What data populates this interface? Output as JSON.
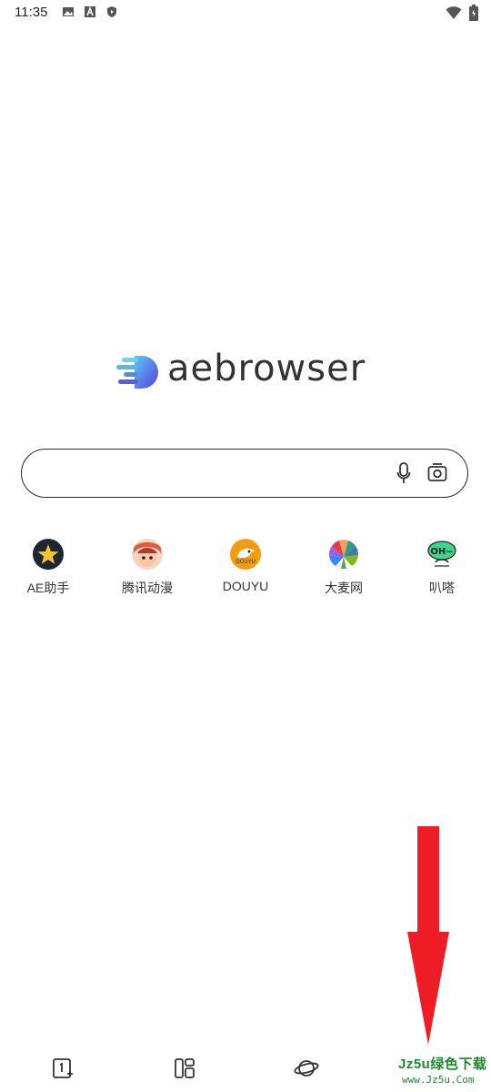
{
  "status_bar": {
    "time": "11:35",
    "icons_left": [
      "image-icon",
      "a-box-icon",
      "shield-play-icon"
    ],
    "icons_right": [
      "wifi-icon",
      "battery-icon"
    ]
  },
  "logo": {
    "text": "aebrowser",
    "accent": "#4a63e6"
  },
  "search": {
    "placeholder": "",
    "value": "",
    "mic_icon": "mic-icon",
    "lens_icon": "camera-lens-icon"
  },
  "shortcuts": [
    {
      "label": "AE助手",
      "icon": "star-icon"
    },
    {
      "label": "腾讯动漫",
      "icon": "anime-face-icon"
    },
    {
      "label": "DOUYU",
      "icon": "douyu-shark-icon"
    },
    {
      "label": "大麦网",
      "icon": "damai-fan-icon"
    },
    {
      "label": "叭嗒",
      "icon": "bada-bubble-icon"
    }
  ],
  "annotation": {
    "arrow_color": "#ee1c25"
  },
  "bottom_nav": {
    "items": [
      "new-tab-icon",
      "layout-icon",
      "planet-icon"
    ]
  },
  "watermark": {
    "top": "Jz5u绿色下载",
    "bottom": "www.Jz5u.Com",
    "color": "#1d8a2b"
  }
}
